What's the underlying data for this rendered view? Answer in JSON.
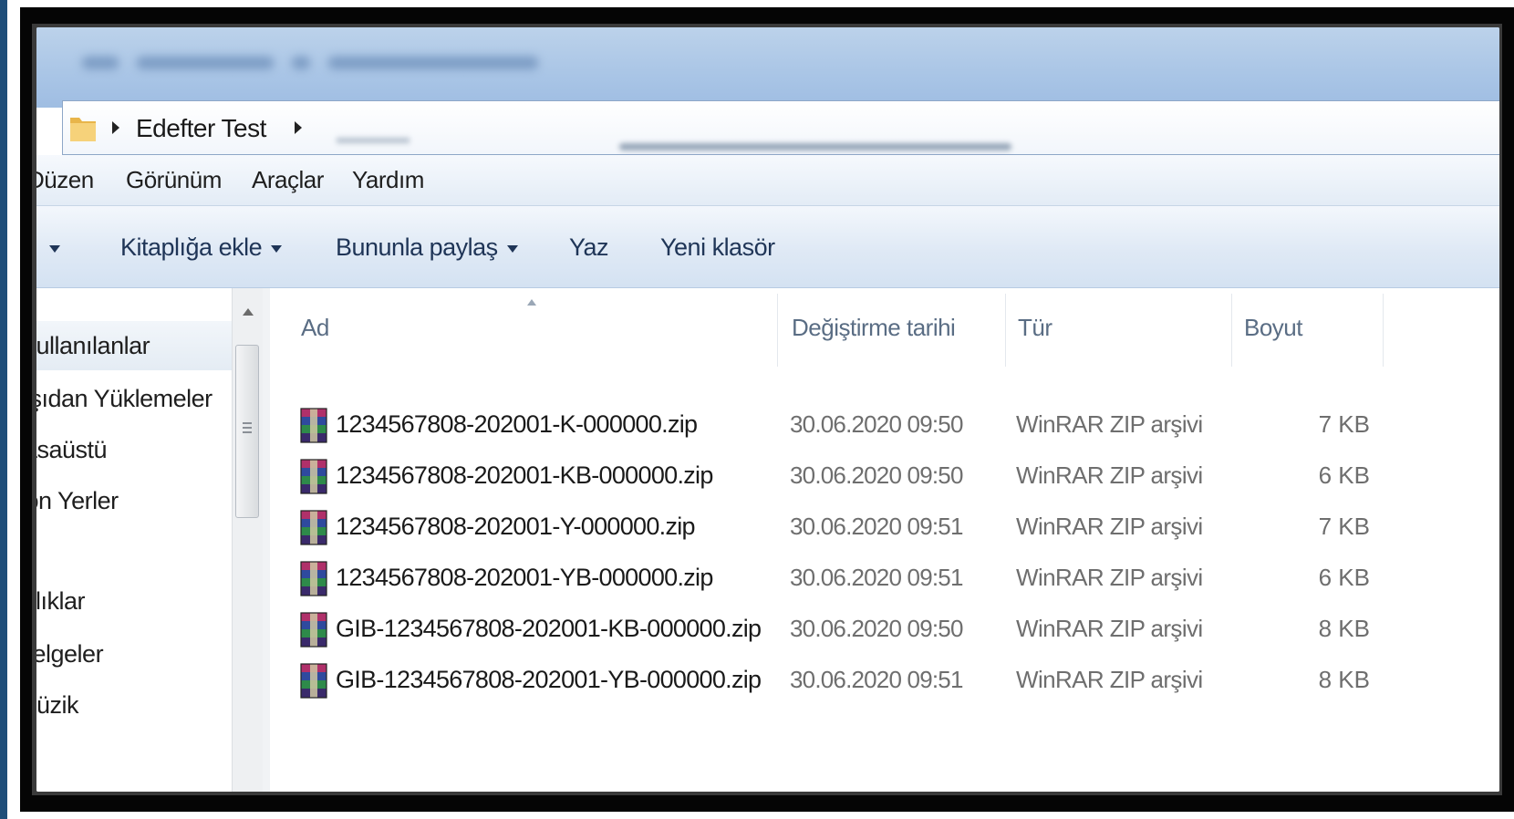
{
  "address": {
    "crumb": "Edefter Test"
  },
  "menu": [
    "Düzen",
    "Görünüm",
    "Araçlar",
    "Yardım"
  ],
  "toolbar": {
    "add_library": "Kitaplığa ekle",
    "share_with": "Bununla paylaş",
    "burn": "Yaz",
    "new_folder": "Yeni klasör"
  },
  "nav": [
    "Kullanılanlar",
    "Karşıdan Yüklemeler",
    "Masaüstü",
    "Son Yerler",
    "Kitaplıklar",
    "Belgeler",
    "Müzik"
  ],
  "columns": {
    "name": "Ad",
    "date": "Değiştirme tarihi",
    "type": "Tür",
    "size": "Boyut"
  },
  "files": [
    {
      "name": "1234567808-202001-K-000000.zip",
      "date": "30.06.2020 09:50",
      "type": "WinRAR ZIP arşivi",
      "size": "7 KB"
    },
    {
      "name": "1234567808-202001-KB-000000.zip",
      "date": "30.06.2020 09:50",
      "type": "WinRAR ZIP arşivi",
      "size": "6 KB"
    },
    {
      "name": "1234567808-202001-Y-000000.zip",
      "date": "30.06.2020 09:51",
      "type": "WinRAR ZIP arşivi",
      "size": "7 KB"
    },
    {
      "name": "1234567808-202001-YB-000000.zip",
      "date": "30.06.2020 09:51",
      "type": "WinRAR ZIP arşivi",
      "size": "6 KB"
    },
    {
      "name": "GIB-1234567808-202001-KB-000000.zip",
      "date": "30.06.2020 09:50",
      "type": "WinRAR ZIP arşivi",
      "size": "8 KB"
    },
    {
      "name": "GIB-1234567808-202001-YB-000000.zip",
      "date": "30.06.2020 09:51",
      "type": "WinRAR ZIP arşivi",
      "size": "8 KB"
    }
  ],
  "colors": {
    "frame": "#050505",
    "accent_strip": "#1f4e79",
    "titlebar": "#a9c5e6",
    "command_text": "#1f3557"
  }
}
